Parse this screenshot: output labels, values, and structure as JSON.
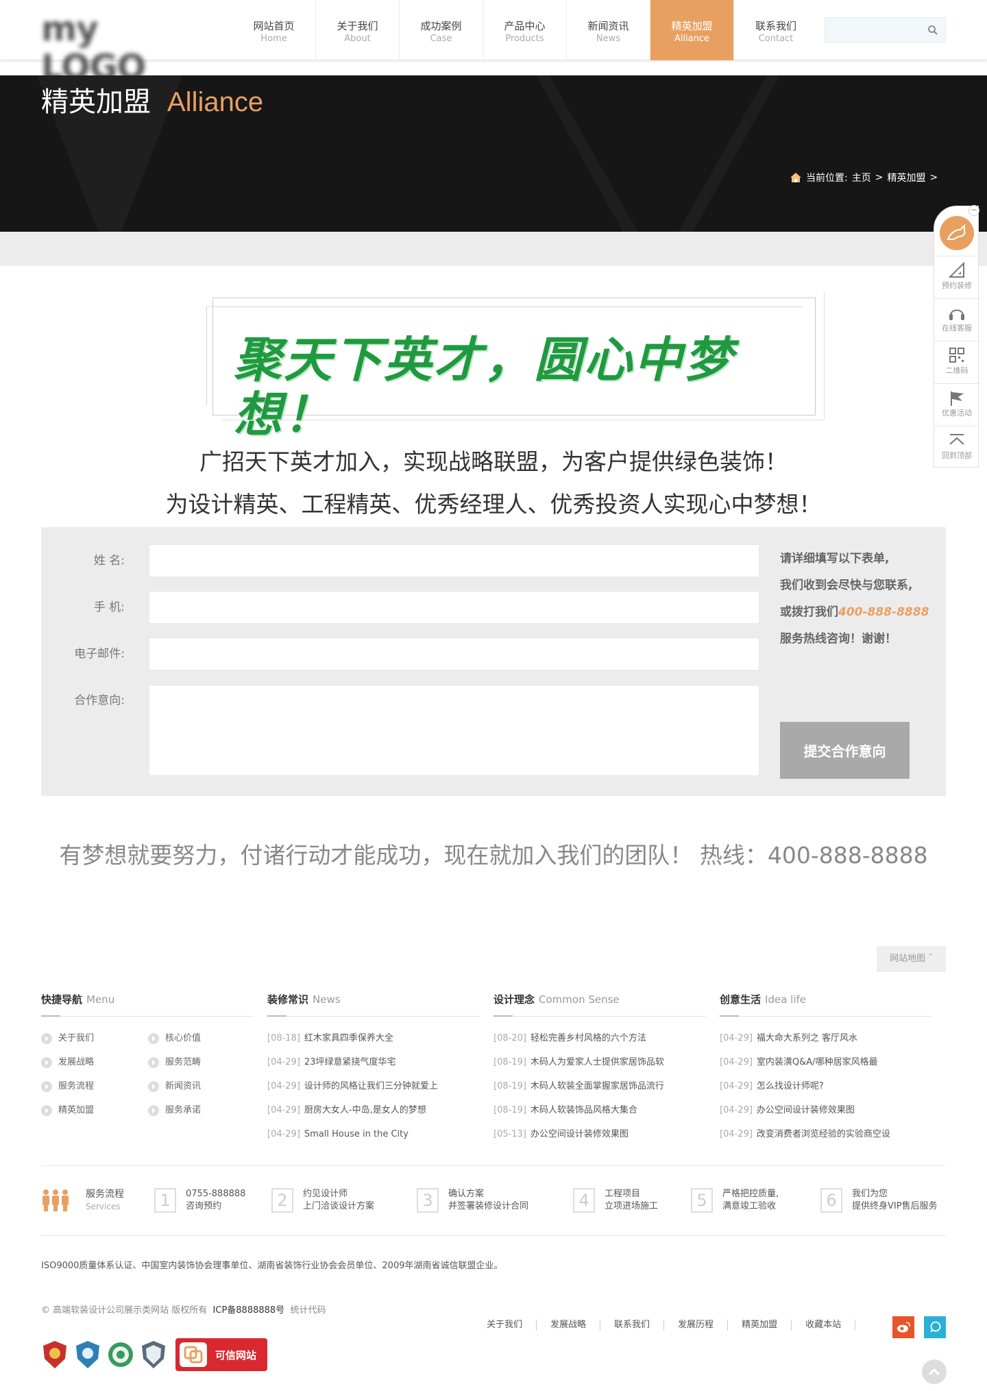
{
  "header": {
    "logo_text": "my LOGO",
    "nav": [
      {
        "cn": "网站首页",
        "en": "Home"
      },
      {
        "cn": "关于我们",
        "en": "About"
      },
      {
        "cn": "成功案例",
        "en": "Case"
      },
      {
        "cn": "产品中心",
        "en": "Products"
      },
      {
        "cn": "新闻资讯",
        "en": "News"
      },
      {
        "cn": "精英加盟",
        "en": "Alliance"
      },
      {
        "cn": "联系我们",
        "en": "Contact"
      }
    ],
    "active_nav": "Alliance",
    "search_placeholder": ""
  },
  "banner": {
    "title_cn": "精英加盟",
    "title_en": "Alliance",
    "breadcrumb_prefix": "当前位置:",
    "breadcrumb_home": "主页",
    "breadcrumb_sep": ">",
    "breadcrumb_current": "精英加盟",
    "breadcrumb_end": ">"
  },
  "slogan": "聚天下英才，圆心中梦想！",
  "intro": {
    "line1": "广招天下英才加入，实现战略联盟，为客户提供绿色装饰！",
    "line2": "为设计精英、工程精英、优秀经理人、优秀投资人实现心中梦想！"
  },
  "form": {
    "name_label": "姓    名:",
    "phone_label": "手    机:",
    "email_label": "电子邮件:",
    "intent_label": "合作意向:",
    "name_value": "",
    "phone_value": "",
    "email_value": "",
    "intent_value": "",
    "note_line1": "请详细填写以下表单,",
    "note_line2": "我们收到会尽快与您联系,",
    "note_line3_prefix": "或拨打我们",
    "note_phone": "400-888-8888",
    "note_line4": "服务热线咨询！谢谢！",
    "submit_label": "提交合作意向"
  },
  "hotline_text": "有梦想就要努力，付诸行动才能成功，现在就加入我们的团队！ 热线：400-888-8888",
  "sidebar": {
    "close": "−",
    "items": [
      {
        "label": "预约装修",
        "icon": "triangle-ruler-icon"
      },
      {
        "label": "在线客服",
        "icon": "headset-icon"
      },
      {
        "label": "二维码",
        "icon": "qrcode-icon"
      },
      {
        "label": "优惠活动",
        "icon": "flag-icon"
      },
      {
        "label": "回到顶部",
        "icon": "arrow-up-icon"
      }
    ]
  },
  "footer": {
    "sitemap_label": "网站地图",
    "columns": [
      {
        "title": "快捷导航",
        "en": "Menu",
        "menu": [
          "关于我们",
          "核心价值",
          "发展战略",
          "服务范畴",
          "服务流程",
          "新闻资讯",
          "精英加盟",
          "服务承诺"
        ]
      },
      {
        "title": "装修常识",
        "en": "News",
        "items": [
          {
            "date": "[08-18]",
            "text": "红木家具四季保养大全"
          },
          {
            "date": "[04-29]",
            "text": "23坪绿意紧挠气度华宅"
          },
          {
            "date": "[04-29]",
            "text": "设计师的风格让我们三分钟就爱上"
          },
          {
            "date": "[04-29]",
            "text": "厨房大女人-中岛,是女人的梦想"
          },
          {
            "date": "[04-29]",
            "text": "Small House in the City"
          }
        ]
      },
      {
        "title": "设计理念",
        "en": "Common Sense",
        "items": [
          {
            "date": "[08-20]",
            "text": "轻松完善乡村风格的六个方法"
          },
          {
            "date": "[08-19]",
            "text": "木码人为爱家人士提供家居饰品软"
          },
          {
            "date": "[08-19]",
            "text": "木码人软装全面掌握家居饰品流行"
          },
          {
            "date": "[08-19]",
            "text": "木码人软装饰品风格大集合"
          },
          {
            "date": "[05-13]",
            "text": "办公空间设计装修效果图"
          }
        ]
      },
      {
        "title": "创意生活",
        "en": "Idea life",
        "items": [
          {
            "date": "[04-29]",
            "text": "福大命大系列之 客厅风水"
          },
          {
            "date": "[04-29]",
            "text": "室内装潢Q&A/哪种居家风格最"
          },
          {
            "date": "[04-29]",
            "text": "怎么找设计师呢?"
          },
          {
            "date": "[04-29]",
            "text": "办公空间设计装修效果图"
          },
          {
            "date": "[04-29]",
            "text": "改变消费者浏览经验的实验商空设"
          }
        ]
      }
    ],
    "services_title": "服务流程",
    "services_en": "Services",
    "steps": [
      {
        "num": "1",
        "line1": "0755-888888",
        "line2": "咨询预约"
      },
      {
        "num": "2",
        "line1": "约见设计师",
        "line2": "上门洽谈设计方案"
      },
      {
        "num": "3",
        "line1": "确认方案",
        "line2": "并签署装修设计合同"
      },
      {
        "num": "4",
        "line1": "工程项目",
        "line2": "立项进场施工"
      },
      {
        "num": "5",
        "line1": "严格把控质量,",
        "line2": "满意竣工验收"
      },
      {
        "num": "6",
        "line1": "我们为您",
        "line2": "提供终身VIP售后服务"
      }
    ],
    "cert_text": "ISO9000质量体系认证、中国室内装饰协会理事单位、湖南省装饰行业协会会员单位、2009年湖南省诚信联盟企业。",
    "copyright": "© 高端软装设计公司展示类网站 版权所有",
    "icp": "ICP备8888888号",
    "stats": "统计代码",
    "links": [
      "关于我们",
      "发展战略",
      "联系我们",
      "发展历程",
      "精英加盟",
      "收藏本站"
    ],
    "kx_text": "可信网站"
  },
  "colors": {
    "accent": "#e8a061",
    "banner_bg": "#161616",
    "slogan_green": "#1f9a3f",
    "weibo": "#e8552b",
    "chat": "#2ab0d6"
  }
}
